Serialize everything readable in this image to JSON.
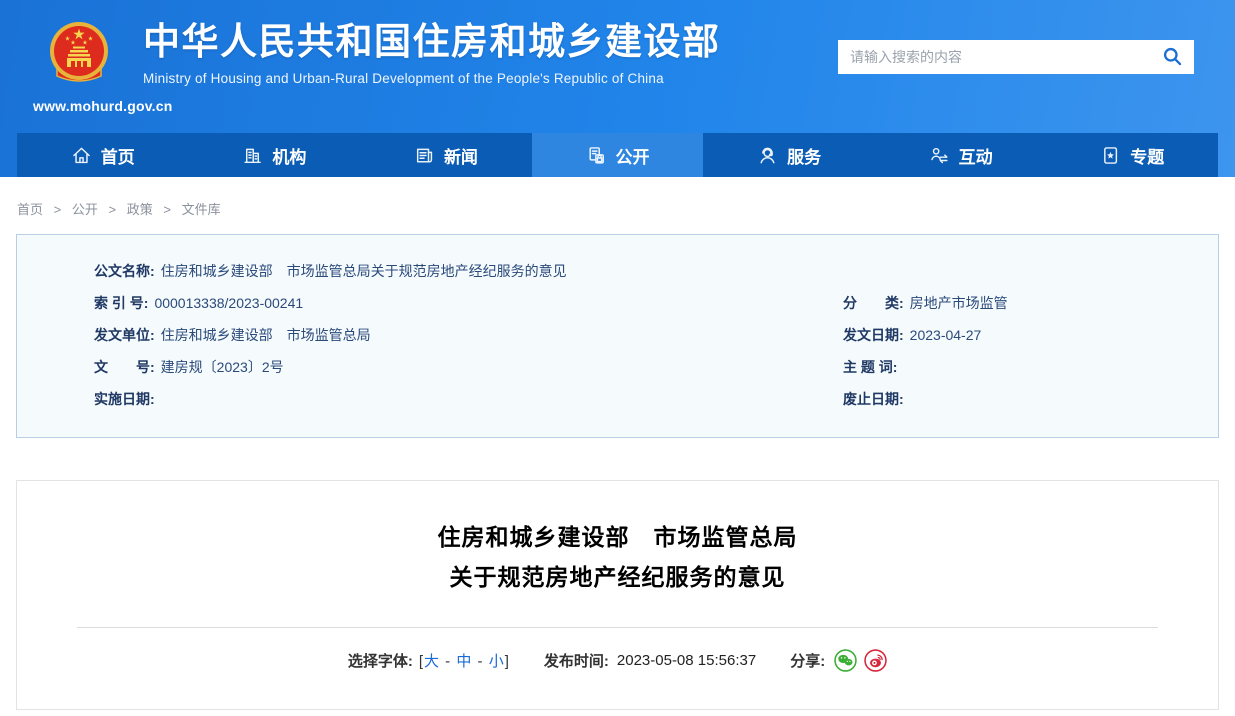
{
  "header": {
    "site_title": "中华人民共和国住房和城乡建设部",
    "site_subtitle": "Ministry of Housing and Urban-Rural Development of the People's Republic of China",
    "site_url": "www.mohurd.gov.cn",
    "search_placeholder": "请输入搜索的内容"
  },
  "nav": {
    "items": [
      {
        "label": "首页",
        "icon": "home-icon",
        "active": false
      },
      {
        "label": "机构",
        "icon": "organization-icon",
        "active": false
      },
      {
        "label": "新闻",
        "icon": "news-icon",
        "active": false
      },
      {
        "label": "公开",
        "icon": "disclosure-icon",
        "active": true
      },
      {
        "label": "服务",
        "icon": "service-icon",
        "active": false
      },
      {
        "label": "互动",
        "icon": "interaction-icon",
        "active": false
      },
      {
        "label": "专题",
        "icon": "topics-icon",
        "active": false
      }
    ]
  },
  "breadcrumb": {
    "items": [
      "首页",
      "公开",
      "政策",
      "文件库"
    ],
    "separator": ">"
  },
  "meta": {
    "name_label": "公文名称:",
    "name_value": "住房和城乡建设部　市场监管总局关于规范房地产经纪服务的意见",
    "left": [
      {
        "label": "索 引 号:",
        "value": "000013338/2023-00241"
      },
      {
        "label": "发文单位:",
        "value": "住房和城乡建设部　市场监管总局"
      },
      {
        "label": "文　　号:",
        "value": "建房规〔2023〕2号"
      },
      {
        "label": "实施日期:",
        "value": ""
      }
    ],
    "right": [
      {
        "label": "分　　类:",
        "value": "房地产市场监管"
      },
      {
        "label": "发文日期:",
        "value": "2023-04-27"
      },
      {
        "label": "主 题 词:",
        "value": ""
      },
      {
        "label": "废止日期:",
        "value": ""
      }
    ]
  },
  "article": {
    "title_line1": "住房和城乡建设部　市场监管总局",
    "title_line2": "关于规范房地产经纪服务的意见",
    "font_label": "选择字体:",
    "font_open": "[",
    "font_large": "大",
    "font_sep1": " - ",
    "font_medium": "中",
    "font_sep2": " - ",
    "font_small": "小",
    "font_close": "]",
    "publish_label": "发布时间:",
    "publish_time": "2023-05-08 15:56:37",
    "share_label": "分享:"
  },
  "colors": {
    "header_blue": "#2185ea",
    "nav_blue": "#0a5cb4",
    "active_tab_blue": "#2e86e0",
    "link_blue": "#1a6ad8",
    "meta_navy": "#24406e",
    "wechat_green": "#3bae36",
    "weibo_red": "#d5283c"
  }
}
